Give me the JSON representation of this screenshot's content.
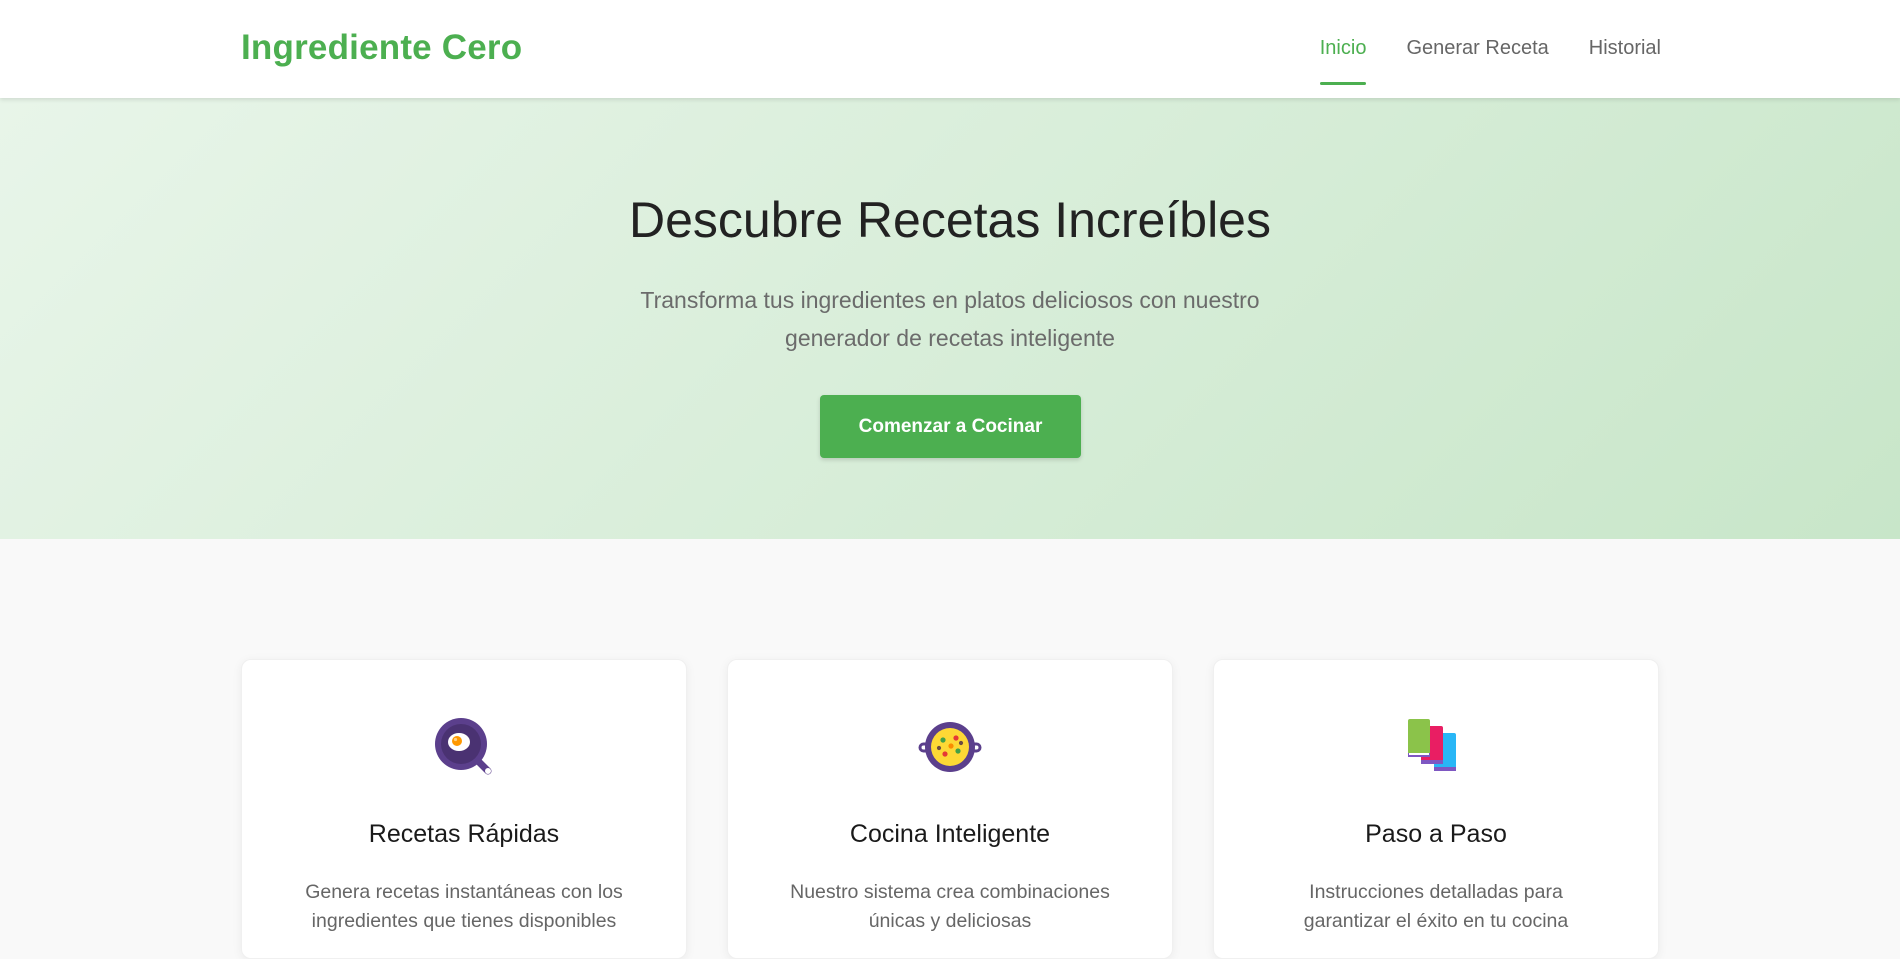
{
  "navbar": {
    "brand": "Ingrediente Cero",
    "links": [
      {
        "label": "Inicio",
        "active": true
      },
      {
        "label": "Generar Receta",
        "active": false
      },
      {
        "label": "Historial",
        "active": false
      }
    ]
  },
  "hero": {
    "title": "Descubre Recetas Increíbles",
    "subtitle": "Transforma tus ingredientes en platos deliciosos con nuestro generador de recetas inteligente",
    "cta_label": "Comenzar a Cocinar"
  },
  "features": [
    {
      "icon": "frying-pan-egg-icon",
      "title": "Recetas Rápidas",
      "text": "Genera recetas instantáneas con los ingredientes que tienes disponibles"
    },
    {
      "icon": "paella-pan-icon",
      "title": "Cocina Inteligente",
      "text": "Nuestro sistema crea combinaciones únicas y deliciosas"
    },
    {
      "icon": "books-icon",
      "title": "Paso a Paso",
      "text": "Instrucciones detalladas para garantizar el éxito en tu cocina"
    }
  ],
  "colors": {
    "accent": "#4caf50",
    "hero_gradient_start": "#e8f5e9",
    "hero_gradient_end": "#c8e6c9",
    "page_background": "#f9f9f9"
  }
}
